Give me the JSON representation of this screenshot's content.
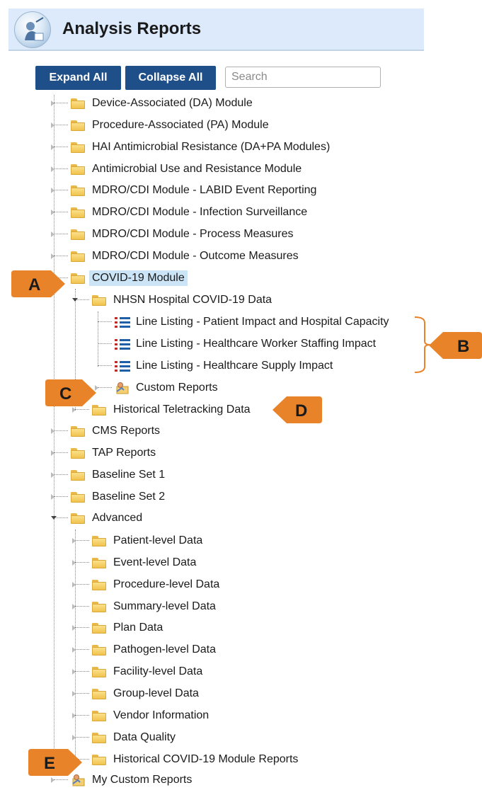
{
  "header": {
    "title": "Analysis Reports"
  },
  "toolbar": {
    "expand_label": "Expand All",
    "collapse_label": "Collapse All",
    "search_placeholder": "Search"
  },
  "tree": {
    "top": [
      "Device-Associated (DA) Module",
      "Procedure-Associated (PA) Module",
      "HAI Antimicrobial Resistance (DA+PA Modules)",
      "Antimicrobial Use and Resistance Module",
      "MDRO/CDI Module - LABID Event Reporting",
      "MDRO/CDI Module - Infection Surveillance",
      "MDRO/CDI Module - Process Measures",
      "MDRO/CDI Module - Outcome Measures"
    ],
    "covid": "COVID-19 Module",
    "nhsn": "NHSN Hospital COVID-19 Data",
    "line_listings": [
      "Line Listing - Patient Impact and Hospital Capacity",
      "Line Listing - Healthcare Worker Staffing Impact",
      "Line Listing - Healthcare Supply Impact"
    ],
    "custom_reports": "Custom Reports",
    "teletracking": "Historical Teletracking Data",
    "mid": [
      "CMS Reports",
      "TAP Reports",
      "Baseline Set 1",
      "Baseline Set 2"
    ],
    "advanced": "Advanced",
    "advanced_children": [
      "Patient-level Data",
      "Event-level Data",
      "Procedure-level Data",
      "Summary-level Data",
      "Plan Data",
      "Pathogen-level Data",
      "Facility-level Data",
      "Group-level Data",
      "Vendor Information",
      "Data Quality",
      "Historical COVID-19 Module Reports"
    ],
    "my_custom": "My Custom Reports"
  },
  "callouts": {
    "a": "A",
    "b": "B",
    "c": "C",
    "d": "D",
    "e": "E"
  },
  "colors": {
    "callout": "#e8832a",
    "button": "#1f4f88",
    "header_bg": "#ddeafb",
    "selection": "#cbe4f6"
  }
}
